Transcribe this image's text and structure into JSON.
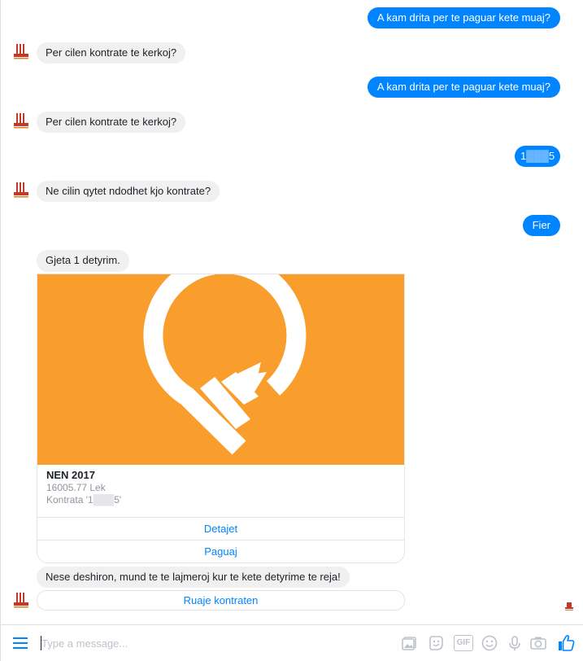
{
  "messages": {
    "user_1": "A kam drita per te paguar kete muaj?",
    "bot_1": "Per cilen kontrate te kerkoj?",
    "user_2": "A kam drita per te paguar kete muaj?",
    "bot_2": "Per cilen kontrate te kerkoj?",
    "user_3": "1",
    "user_3_masked": "███",
    "user_3_tail": "5",
    "bot_3": "Ne cilin qytet ndodhet kjo kontrate?",
    "user_4": "Fier",
    "bot_4": "Gjeta 1 detyrim.",
    "bot_5": "Nese deshiron, mund te te lajmeroj kur te kete detyrime te reja!"
  },
  "card": {
    "title": "NEN 2017",
    "amount": "16005.77 Lek",
    "contract_prefix": "Kontrata '1",
    "contract_masked": "███",
    "contract_suffix": "5'",
    "button_details": "Detajet",
    "button_pay": "Paguaj"
  },
  "quick_reply": {
    "label": "Ruaje kontraten"
  },
  "composer": {
    "placeholder": "Type a message...",
    "icons": [
      "menu-icon",
      "image-icon",
      "sticker-icon",
      "gif-icon",
      "emoji-icon",
      "microphone-icon",
      "camera-icon",
      "like-icon"
    ],
    "gif_label": "GIF"
  },
  "colors": {
    "user_bubble": "#0084ff",
    "bot_bubble": "#f1f0f0",
    "card_image_bg": "#f99e2d",
    "link_blue": "#0084ff",
    "icon_gray": "#bec2c9"
  }
}
